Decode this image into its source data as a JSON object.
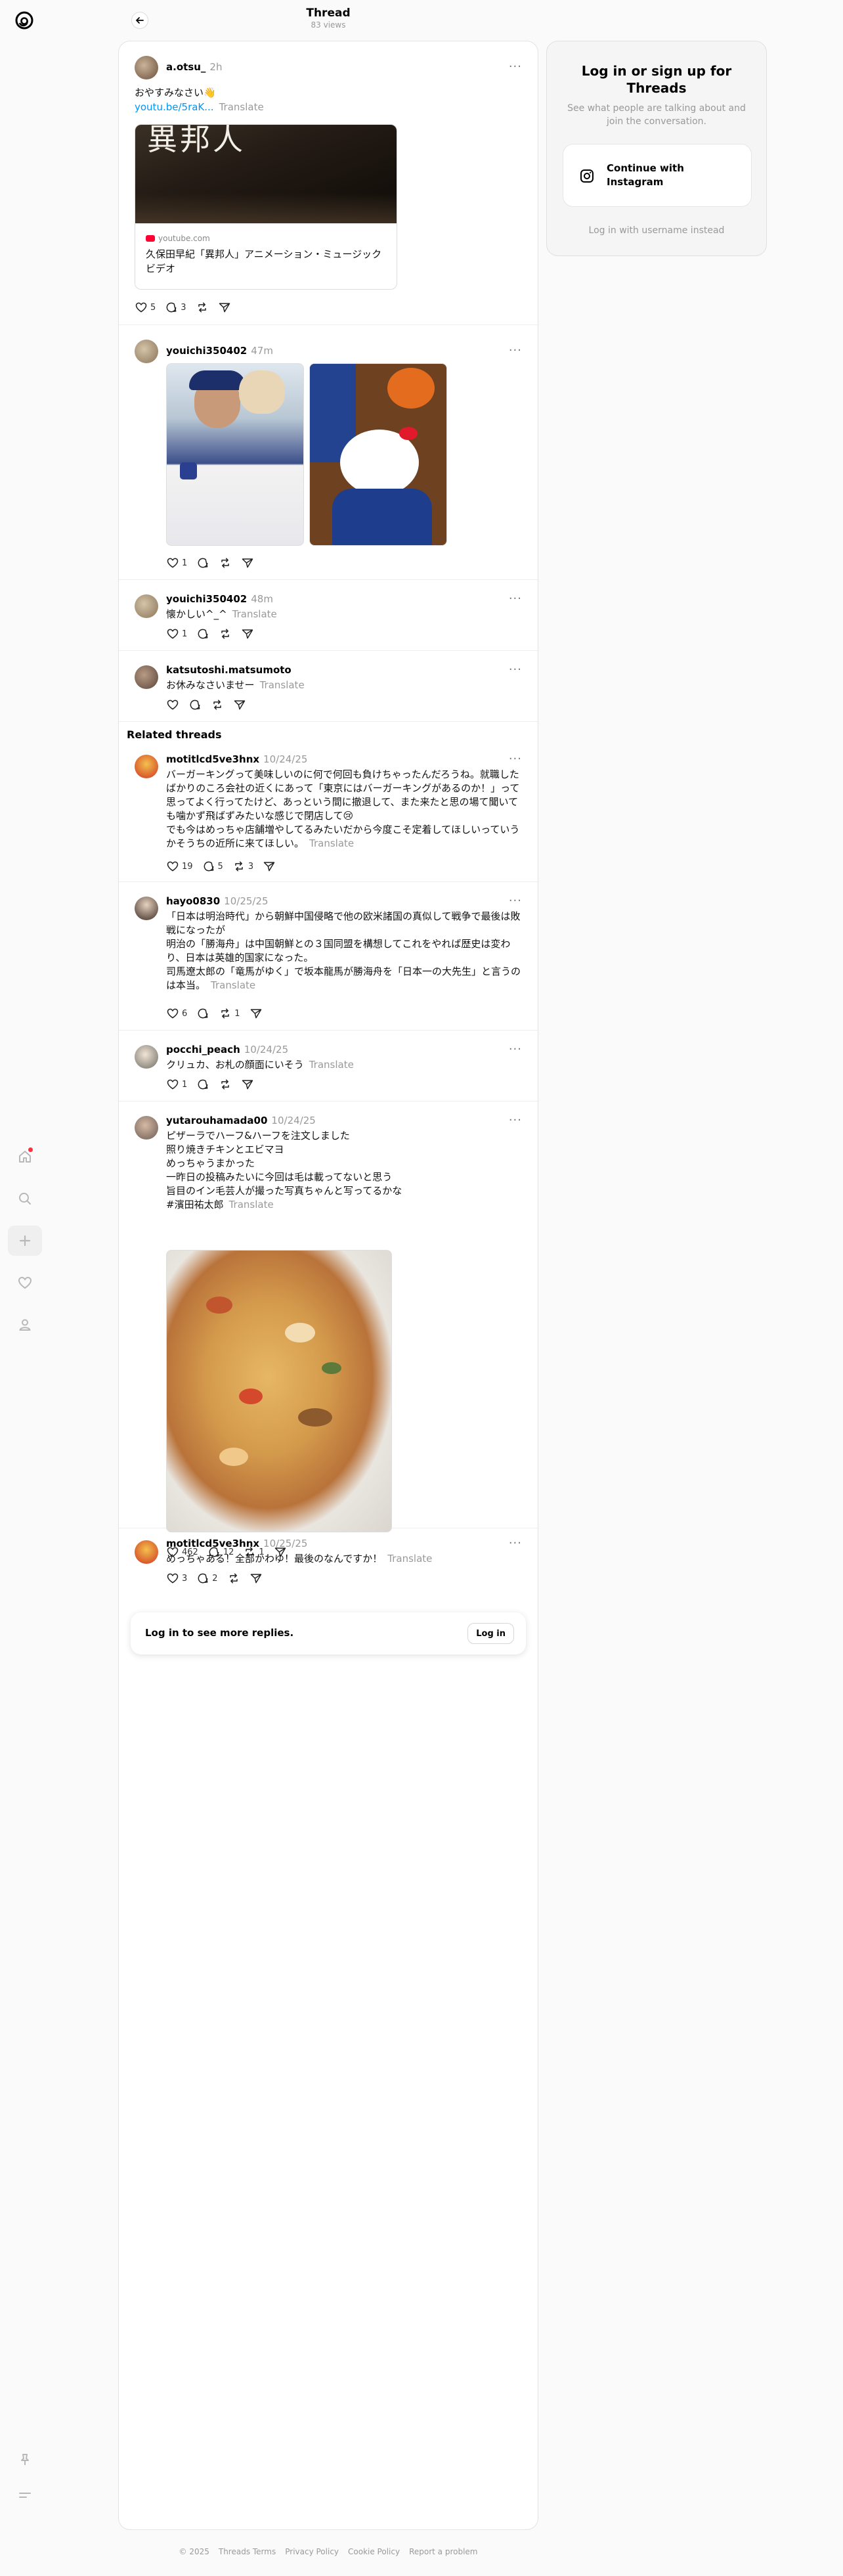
{
  "header": {
    "title": "Thread",
    "views": "83 views"
  },
  "nav": [
    "home-icon",
    "search-icon",
    "create-icon",
    "activity-icon",
    "profile-icon",
    "pin-icon",
    "menu-icon"
  ],
  "main_post": {
    "user": "a.otsu_",
    "time": "2h",
    "text": "おやすみなさい👋",
    "link": "youtu.be/5raK...",
    "translate": "Translate",
    "card_source": "youtube.com",
    "card_title": "久保田早紀「異邦人」アニメーション・ミュージックビデオ",
    "card_overlay": "異邦人",
    "likes": "5",
    "replies": "3"
  },
  "reply1": {
    "user": "youichi350402",
    "time": "47m",
    "likes": "1"
  },
  "reply2": {
    "user": "youichi350402",
    "time": "48m",
    "text": "懐かしい^_^",
    "translate": "Translate",
    "likes": "1"
  },
  "reply3": {
    "user": "katsutoshi.matsumoto",
    "time": "2h",
    "text": "お休みなさいませー",
    "translate": "Translate"
  },
  "related_title": "Related threads",
  "related": [
    {
      "user": "motitlcd5ve3hnx",
      "time": "10/24/25",
      "lines": [
        "バーガーキングって美味しいのに何で何回も負けちゃったんだろうね。就職したばかりのころ会社の近くにあって「東京にはバーガーキングがあるのか！」って思ってよく行ってたけど、あっという間に撤退して、また来たと思の場て聞いても噛かず飛ばずみたいな感じで閉店して😢",
        "でも今はめっちゃ店舗増やしてるみたいだから今度こそ定着してほしいっていうかそうちの近所に来てほしい。"
      ],
      "translate": "Translate",
      "likes": "19",
      "replies": "5",
      "reposts": "3"
    },
    {
      "user": "hayo0830",
      "time": "10/25/25",
      "lines": [
        "「日本は明治時代」から朝鮮中国侵略で他の欧米諸国の真似して戦争で最後は敗戦になったが",
        "明治の「勝海舟」は中国朝鮮との３国同盟を構想してこれをやれば歴史は変わり、日本は英雄的国家になった。",
        "司馬遼太郎の「竜馬がゆく」で坂本龍馬が勝海舟を「日本一の大先生」と言うのは本当。"
      ],
      "translate": "Translate",
      "likes": "6",
      "replies": "",
      "reposts": "1"
    },
    {
      "user": "pocchi_peach",
      "time": "10/24/25",
      "lines": [
        "クリュカ、お札の顔面にいそう"
      ],
      "translate": "Translate",
      "likes": "1"
    },
    {
      "user": "yutarouhamada00",
      "time": "10/24/25",
      "lines": [
        "ピザーラでハーフ&ハーフを注文しました",
        "照り焼きチキンとエビマヨ",
        "めっちゃうまかった",
        "一昨日の投稿みたいに今回は毛は載ってないと思う",
        "旨目のイン毛芸人が撮った写真ちゃんと写ってるかな",
        "#濱田祐太郎"
      ],
      "translate": "Translate",
      "likes": "462",
      "replies": "12",
      "reposts": "1"
    },
    {
      "user": "motitlcd5ve3hnx",
      "time": "10/25/25",
      "lines": [
        "めっちゃある！全部かわゆ！最後のなんですか！"
      ],
      "translate": "Translate",
      "likes": "3",
      "replies": "2"
    }
  ],
  "login_bar": {
    "text": "Log in to see more replies.",
    "button": "Log in"
  },
  "signup": {
    "title": "Log in or sign up for Threads",
    "subtitle": "See what people are talking about and join the conversation.",
    "instagram": "Continue with Instagram",
    "username": "Log in with username instead"
  },
  "footer": [
    "© 2025",
    "Threads Terms",
    "Privacy Policy",
    "Cookie Policy",
    "Report a problem"
  ],
  "colors": {
    "link": "#0095f6",
    "muted": "#999999",
    "notification": "#ff3040"
  }
}
